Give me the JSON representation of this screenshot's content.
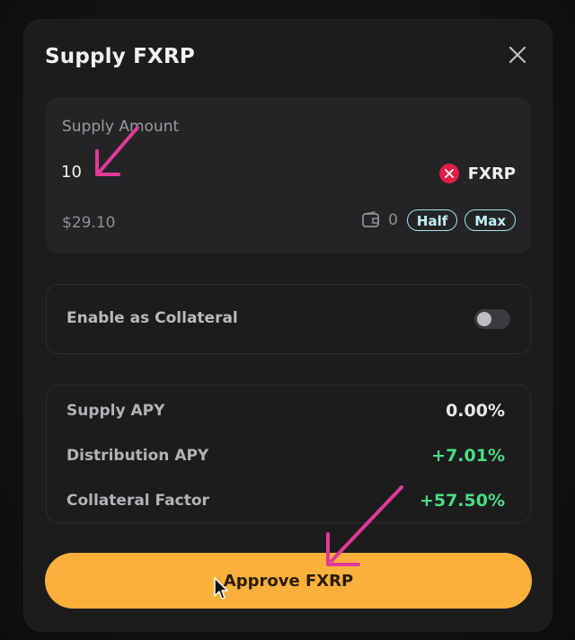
{
  "modal": {
    "title": "Supply FXRP"
  },
  "amount": {
    "label": "Supply Amount",
    "value": "10",
    "token": "FXRP",
    "usd_value": "$29.10",
    "wallet_balance": "0",
    "half_label": "Half",
    "max_label": "Max"
  },
  "collateral": {
    "label": "Enable as Collateral",
    "enabled": false
  },
  "stats": [
    {
      "label": "Supply APY",
      "value": "0.00%"
    },
    {
      "label": "Distribution APY",
      "value": "+7.01%"
    },
    {
      "label": "Collateral Factor",
      "value": "+57.50%"
    }
  ],
  "action": {
    "approve_label": "Approve FXRP"
  },
  "colors": {
    "accent": "#fbb03b",
    "positive": "#4ade80",
    "token_icon": "#e11d48",
    "pill_border": "#9fe6e8",
    "annotation_arrow": "#e0399a"
  }
}
